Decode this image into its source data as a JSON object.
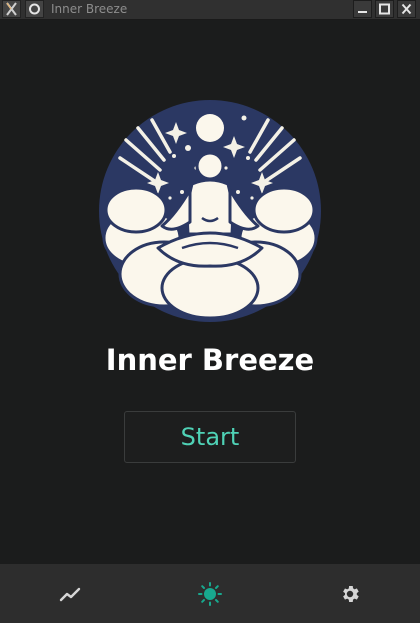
{
  "window": {
    "title": "Inner Breeze"
  },
  "titlebar": {
    "app_icon": "x-app-icon",
    "menu_icon": "window-menu-icon",
    "controls": [
      "minimize-icon",
      "maximize-icon",
      "close-icon"
    ]
  },
  "main": {
    "logo": "meditation-logo",
    "app_title": "Inner Breeze",
    "start_label": "Start"
  },
  "bottom_nav": {
    "items": [
      {
        "icon": "chart-line-icon",
        "active": false
      },
      {
        "icon": "sun-icon",
        "active": true
      },
      {
        "icon": "gear-icon",
        "active": false
      }
    ]
  },
  "colors": {
    "background": "#1b1c1c",
    "accent": "#4fd2b6",
    "logo_navy": "#2b3863",
    "logo_cream": "#fbf7ec",
    "nav_active": "#18a88e",
    "nav_inactive": "#d6d6d6"
  }
}
